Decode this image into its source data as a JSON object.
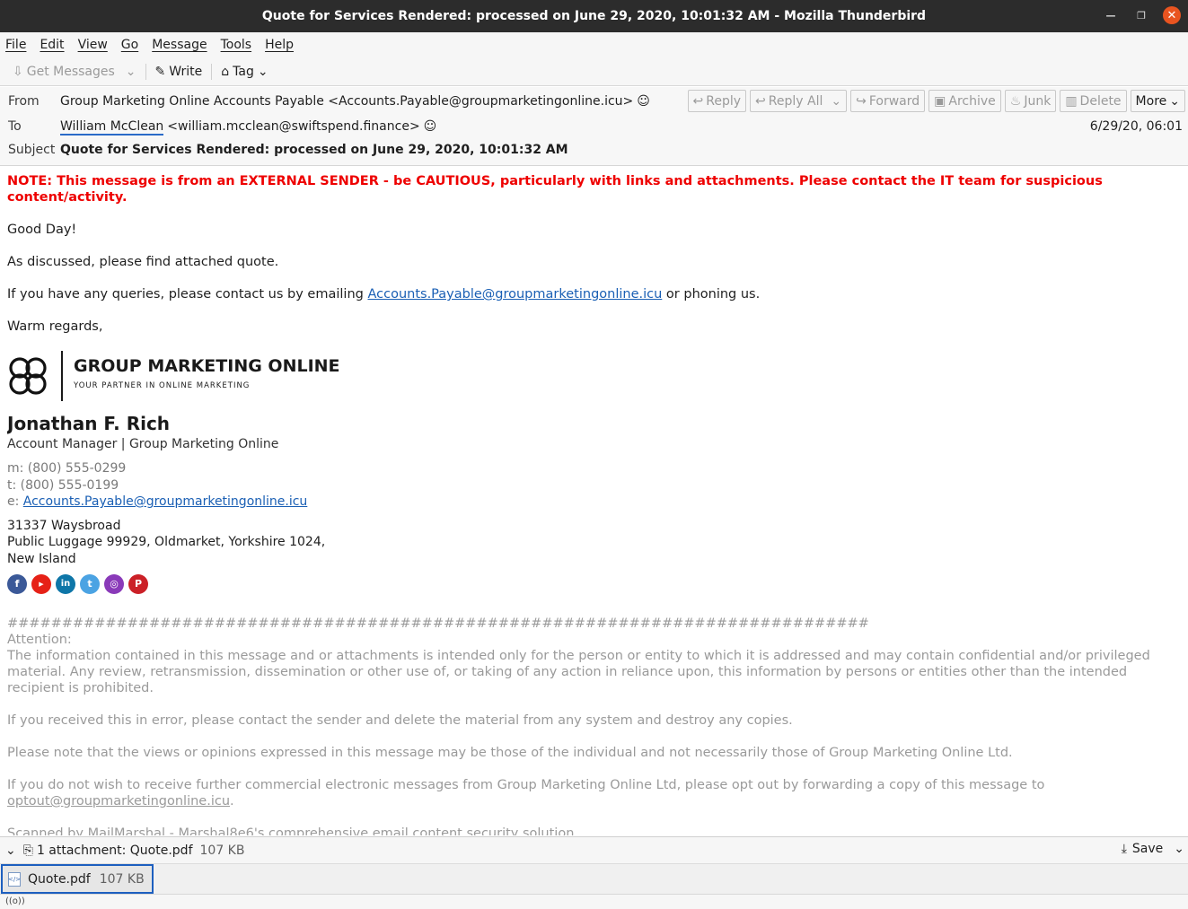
{
  "window": {
    "title": "Quote for Services Rendered: processed on June 29, 2020, 10:01:32 AM - Mozilla Thunderbird"
  },
  "menu": [
    "File",
    "Edit",
    "View",
    "Go",
    "Message",
    "Tools",
    "Help"
  ],
  "toolbar": {
    "get_messages": "Get Messages",
    "write": "Write",
    "tag": "Tag"
  },
  "header": {
    "from_label": "From",
    "from_value": "Group Marketing Online Accounts Payable <Accounts.Payable@groupmarketingonline.icu>",
    "to_label": "To",
    "to_name": "William McClean",
    "to_email": "<william.mcclean@swiftspend.finance>",
    "subject_label": "Subject",
    "subject_value": "Quote for Services Rendered: processed on June 29, 2020, 10:01:32 AM",
    "date": "6/29/20, 06:01",
    "actions": {
      "reply": "Reply",
      "reply_all": "Reply All",
      "forward": "Forward",
      "archive": "Archive",
      "junk": "Junk",
      "delete": "Delete",
      "more": "More"
    }
  },
  "body": {
    "note": "NOTE: This message is from an EXTERNAL SENDER - be CAUTIOUS, particularly with links and attachments. Please contact the IT team for suspicious content/activity.",
    "greeting": "Good Day!",
    "line1": "As discussed, please find attached quote.",
    "line2_pre": "If you have any queries, please contact us by emailing ",
    "line2_link": "Accounts.Payable@groupmarketingonline.icu",
    "line2_post": " or phoning us.",
    "closing": "Warm regards,",
    "logo_title": "GROUP MARKETING ONLINE",
    "logo_sub": "YOUR PARTNER IN ONLINE MARKETING",
    "sig_name": "Jonathan F. Rich",
    "sig_title": "Account Manager | Group Marketing Online",
    "sig_m": "m: (800) 555-0299",
    "sig_t": "t: (800) 555-0199",
    "sig_e_label": "e: ",
    "sig_e_link": "Accounts.Payable@groupmarketingonline.icu",
    "addr1": "31337 Waysbroad",
    "addr2": "Public Luggage 99929, Oldmarket, Yorkshire 1024,",
    "addr3": "New Island",
    "social": [
      "facebook-icon",
      "youtube-icon",
      "linkedin-icon",
      "twitter-icon",
      "instagram-icon",
      "pinterest-icon"
    ],
    "hashes": "###############################################################################",
    "attention": "Attention:",
    "disc1": "The information contained in this message and or attachments is intended only for the person or entity to which it is addressed and may contain confidential and/or privileged material. Any review, retransmission, dissemination or other use of, or taking of any action in reliance upon, this information by persons or entities other than the intended recipient is prohibited.",
    "disc2": "If you received this in error, please contact the sender and delete the material from any system and destroy any copies.",
    "disc3": "Please note that the views or opinions expressed in this message may be those of the individual and not necessarily those of Group Marketing Online Ltd.",
    "disc4_pre": "If you do not wish to receive further commercial electronic messages from Group Marketing Online Ltd, please opt out by forwarding a copy of this message to ",
    "disc4_link": "optout@groupmarketingonline.icu",
    "disc4_post": ".",
    "disc5": "Scanned by MailMarshal - Marshal8e6's comprehensive email content security solution."
  },
  "attachments": {
    "summary": "1 attachment: Quote.pdf",
    "summary_size": "107 KB",
    "save": "Save",
    "file_name": "Quote.pdf",
    "file_size": "107 KB"
  },
  "status": {
    "icon_text": "((o))"
  }
}
